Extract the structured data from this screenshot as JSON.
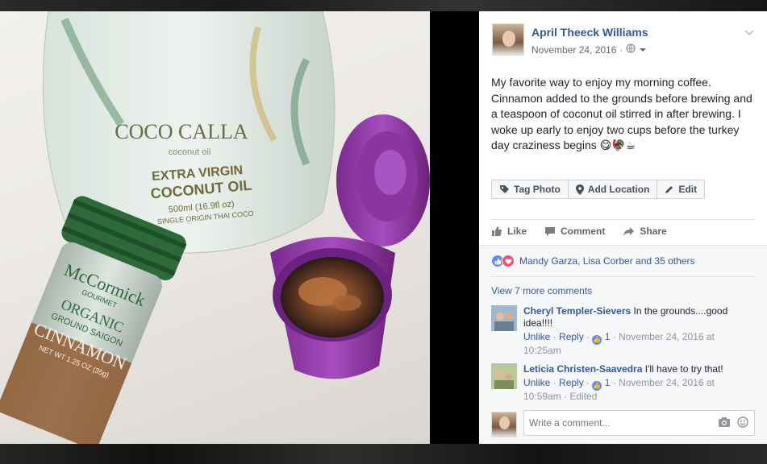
{
  "post": {
    "author": "April Theeck Williams",
    "date": "November 24, 2016",
    "privacy_icon": "globe-icon",
    "text": "My favorite way to enjoy my morning coffee. Cinnamon added to the grounds before brewing and a teaspoon of coconut oil stirred in after brewing. I woke up early to enjoy two cups before the turkey day craziness begins 😋🦃☕",
    "buttons": {
      "tag_photo": "Tag Photo",
      "add_location": "Add Location",
      "edit": "Edit"
    }
  },
  "actions": {
    "like": "Like",
    "comment": "Comment",
    "share": "Share"
  },
  "reactions": {
    "summary": "Mandy Garza, Lisa Corber and 35 others"
  },
  "comments": {
    "view_more": "View 7 more comments",
    "items": [
      {
        "name": "Cheryl Templer-Sievers",
        "text": " In the grounds....good idea!!!!",
        "unlike": "Unlike",
        "reply": "Reply",
        "likes": "1",
        "time": "November 24, 2016 at 10:25am",
        "edited": ""
      },
      {
        "name": "Leticia Christen-Saavedra",
        "text": " I'll have to try that!",
        "unlike": "Unlike",
        "reply": "Reply",
        "likes": "1",
        "time": "November 24, 2016 at 10:59am",
        "edited": "Edited"
      }
    ],
    "write_placeholder": "Write a comment..."
  },
  "photo": {
    "jar_brand": "COCO CALLA",
    "jar_sub": "coconut oil",
    "jar_line1": "EXTRA VIRGIN",
    "jar_line2": "COCONUT OIL",
    "jar_small": "500ml (16.9fl oz)",
    "jar_small2": "SINGLE ORIGIN THAI COCO",
    "spice_brand": "McCormick",
    "spice_gourmet": "GOURMET",
    "spice_organic": "ORGANIC",
    "spice_ground": "GROUND SAIGON",
    "spice_name": "CINNAMON",
    "spice_net": "NET WT 1.25 OZ (35g)"
  },
  "colors": {
    "link_blue": "#365899",
    "lid_purple": "#9b3fb0",
    "spice_green": "#2c6a38"
  }
}
